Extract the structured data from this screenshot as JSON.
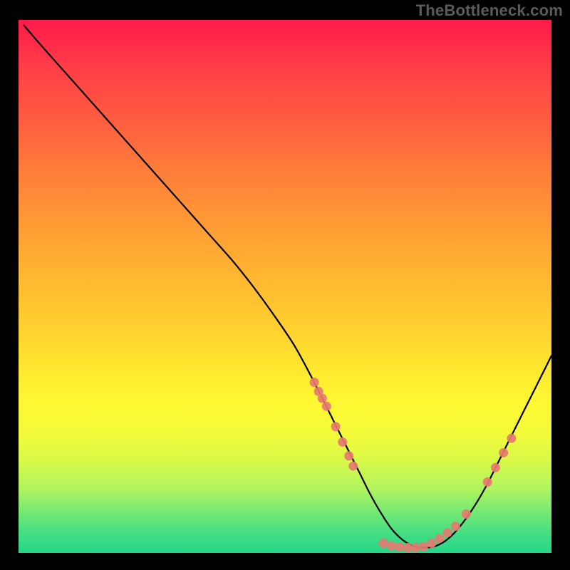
{
  "watermark": "TheBottleneck.com",
  "chart_data": {
    "type": "line",
    "title": "",
    "xlabel": "",
    "ylabel": "",
    "xlim": [
      0,
      100
    ],
    "ylim": [
      0,
      100
    ],
    "grid": false,
    "legend": false,
    "series": [
      {
        "name": "curve",
        "x": [
          1,
          4,
          8,
          12,
          16,
          20,
          24,
          28,
          32,
          36,
          40,
          44,
          48,
          52,
          56,
          58,
          60,
          62,
          64,
          66,
          68,
          70,
          72,
          74,
          76,
          78,
          80,
          82,
          84,
          86,
          88,
          90,
          92,
          94,
          96,
          98,
          100
        ],
        "y": [
          99,
          95.5,
          91,
          86.5,
          82,
          77.5,
          73,
          68.5,
          64,
          59.5,
          55,
          50,
          44.5,
          38.5,
          31,
          27,
          23,
          19,
          15,
          11,
          7.5,
          4.5,
          2.5,
          1.3,
          1,
          1.2,
          2.2,
          4,
          6.5,
          9.5,
          13,
          17,
          21,
          25,
          29,
          33,
          37
        ]
      }
    ],
    "scatter_overlay": {
      "name": "markers",
      "color": "#e77a70",
      "points": [
        {
          "x": 55.5,
          "y": 32.0
        },
        {
          "x": 56.3,
          "y": 30.3
        },
        {
          "x": 57.0,
          "y": 29.0
        },
        {
          "x": 57.8,
          "y": 27.5
        },
        {
          "x": 59.5,
          "y": 23.7
        },
        {
          "x": 60.8,
          "y": 20.8
        },
        {
          "x": 62.0,
          "y": 18.2
        },
        {
          "x": 62.8,
          "y": 16.3
        },
        {
          "x": 68.5,
          "y": 1.8
        },
        {
          "x": 70.0,
          "y": 1.3
        },
        {
          "x": 71.5,
          "y": 1.1
        },
        {
          "x": 73.0,
          "y": 1.0
        },
        {
          "x": 74.5,
          "y": 1.0
        },
        {
          "x": 76.0,
          "y": 1.2
        },
        {
          "x": 77.5,
          "y": 1.8
        },
        {
          "x": 79.0,
          "y": 2.7
        },
        {
          "x": 80.5,
          "y": 3.8
        },
        {
          "x": 82.0,
          "y": 5.0
        },
        {
          "x": 84.0,
          "y": 7.3
        },
        {
          "x": 88.0,
          "y": 13.3
        },
        {
          "x": 89.5,
          "y": 16.0
        },
        {
          "x": 91.0,
          "y": 18.8
        },
        {
          "x": 92.5,
          "y": 21.5
        }
      ]
    },
    "gradient_stops": [
      {
        "pos": 0,
        "color": "#ff1a4a"
      },
      {
        "pos": 8,
        "color": "#ff3a47"
      },
      {
        "pos": 18,
        "color": "#ff5a41"
      },
      {
        "pos": 28,
        "color": "#ff7c3a"
      },
      {
        "pos": 38,
        "color": "#ff9a35"
      },
      {
        "pos": 48,
        "color": "#ffb631"
      },
      {
        "pos": 58,
        "color": "#ffd12f"
      },
      {
        "pos": 66,
        "color": "#ffe92f"
      },
      {
        "pos": 72,
        "color": "#fff833"
      },
      {
        "pos": 78,
        "color": "#f2fb3a"
      },
      {
        "pos": 83,
        "color": "#d6f94a"
      },
      {
        "pos": 88,
        "color": "#b0f45e"
      },
      {
        "pos": 92,
        "color": "#7aea72"
      },
      {
        "pos": 96,
        "color": "#47df82"
      },
      {
        "pos": 100,
        "color": "#25d68a"
      }
    ]
  }
}
